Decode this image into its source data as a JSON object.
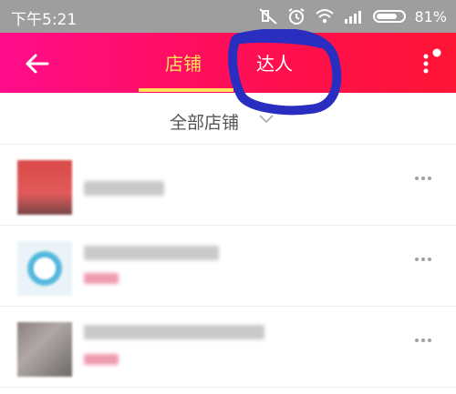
{
  "status_bar": {
    "time": "下午5:21",
    "battery": "81%"
  },
  "nav": {
    "tabs": [
      {
        "label": "店铺",
        "active": true
      },
      {
        "label": "达人",
        "active": false
      }
    ]
  },
  "filter": {
    "label": "全部店铺"
  },
  "colors": {
    "nav_gradient_start": "#ff0d8a",
    "nav_gradient_end": "#ff1535",
    "active_tab": "#ffe25a",
    "annotation": "#2a2ec0"
  },
  "icons": [
    "back-arrow-icon",
    "more-vertical-icon",
    "chevron-down-icon",
    "more-horizontal-icon",
    "silent-icon",
    "alarm-icon",
    "wifi-icon",
    "signal-icon",
    "battery-icon"
  ]
}
